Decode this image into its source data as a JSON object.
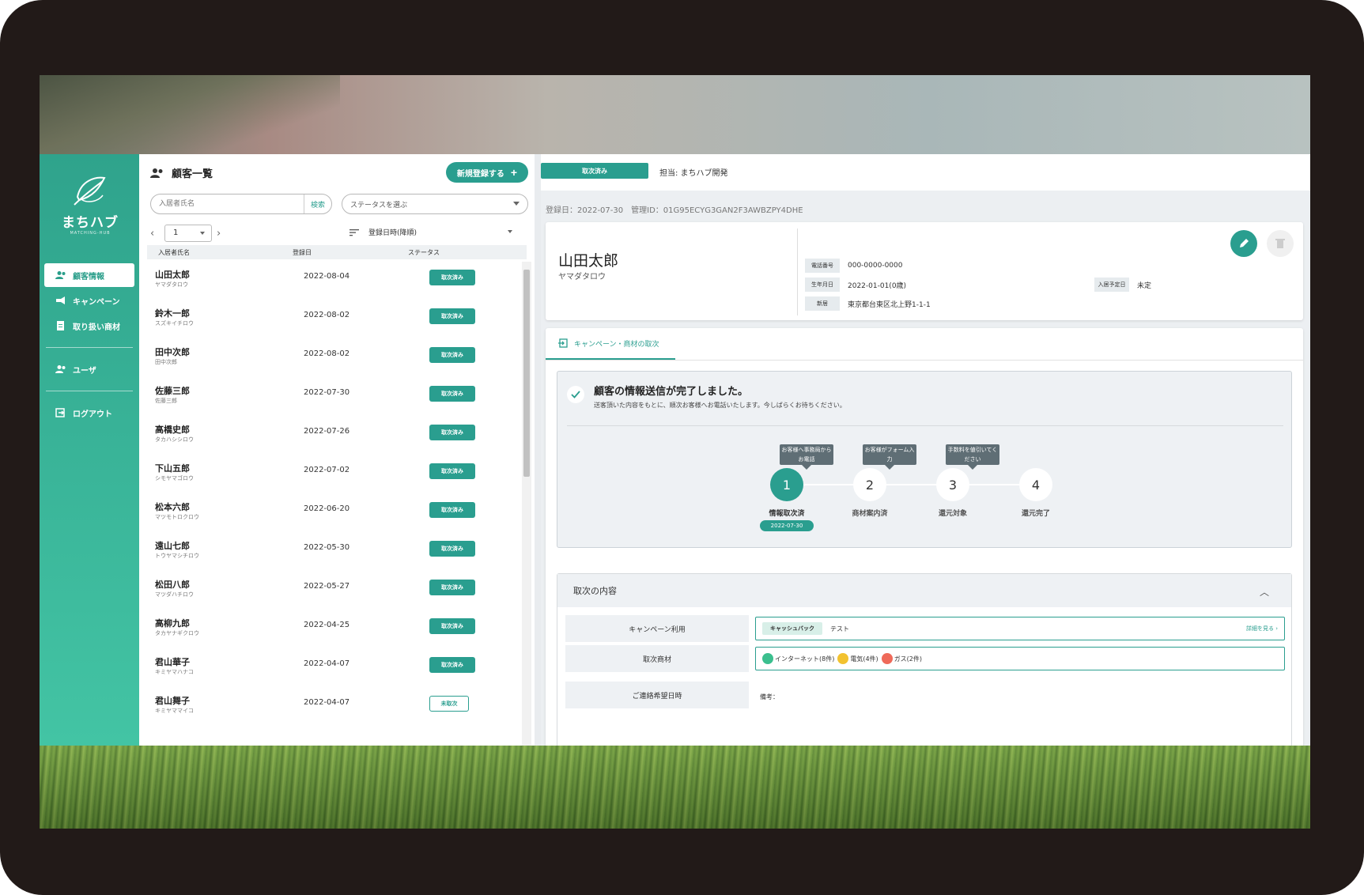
{
  "brand": {
    "name": "まちハブ",
    "sub": "MATCHING-HUB"
  },
  "sidebar": {
    "items": [
      {
        "label": "顧客情報",
        "icon": "users-icon",
        "active": true
      },
      {
        "label": "キャンペーン",
        "icon": "megaphone-icon"
      },
      {
        "label": "取り扱い商材",
        "icon": "document-icon"
      },
      {
        "label": "ユーザ",
        "icon": "users-icon"
      },
      {
        "label": "ログアウト",
        "icon": "logout-icon"
      }
    ]
  },
  "list": {
    "title": "顧客一覧",
    "new_button": "新規登録する",
    "search_placeholder": "入居者氏名",
    "search_button": "検索",
    "status_placeholder": "ステータスを選ぶ",
    "page": "1",
    "sort_label": "登録日時(降順)",
    "columns": {
      "name": "入居者氏名",
      "date": "登録日",
      "status": "ステータス"
    },
    "rows": [
      {
        "name": "山田太郎",
        "kana": "ヤマダタロウ",
        "date": "2022-08-04",
        "status": "取次済み"
      },
      {
        "name": "鈴木一郎",
        "kana": "スズキイチロウ",
        "date": "2022-08-02",
        "status": "取次済み"
      },
      {
        "name": "田中次郎",
        "kana": "田中次郎",
        "date": "2022-08-02",
        "status": "取次済み"
      },
      {
        "name": "佐藤三郎",
        "kana": "佐藤三郎",
        "date": "2022-07-30",
        "status": "取次済み"
      },
      {
        "name": "高橋史郎",
        "kana": "タカハシシロウ",
        "date": "2022-07-26",
        "status": "取次済み"
      },
      {
        "name": "下山五郎",
        "kana": "シモヤマゴロウ",
        "date": "2022-07-02",
        "status": "取次済み"
      },
      {
        "name": "松本六郎",
        "kana": "マツモトロクロウ",
        "date": "2022-06-20",
        "status": "取次済み"
      },
      {
        "name": "遠山七郎",
        "kana": "トウヤマシチロウ",
        "date": "2022-05-30",
        "status": "取次済み"
      },
      {
        "name": "松田八郎",
        "kana": "マツダハチロウ",
        "date": "2022-05-27",
        "status": "取次済み"
      },
      {
        "name": "高柳九郎",
        "kana": "タカヤナギクロウ",
        "date": "2022-04-25",
        "status": "取次済み"
      },
      {
        "name": "君山華子",
        "kana": "キミヤマハナコ",
        "date": "2022-04-07",
        "status": "取次済み"
      },
      {
        "name": "君山舞子",
        "kana": "キミヤママイコ",
        "date": "2022-04-07",
        "status": "未取次"
      }
    ]
  },
  "detail": {
    "status": "取次済み",
    "owner": "担当: まちハブ開発",
    "meta": "登録日：2022-07-30　管理ID：01G95ECYG3GAN2F3AWBZPY4DHE",
    "customer": {
      "name": "山田太郎",
      "kana": "ヤマダタロウ",
      "phone_label": "電話番号",
      "phone": "000-0000-0000",
      "birth_label": "生年月日",
      "birth": "2022-01-01(0歳)",
      "address_label": "新居",
      "address": "東京都台東区北上野1-1-1",
      "movein_label": "入居予定日",
      "movein": "未定"
    },
    "tab": "キャンペーン・商材の取次",
    "done_title": "顧客の情報送信が完了しました。",
    "done_sub": "送客頂いた内容をもとに、順次お客様へお電話いたします。今しばらくお待ちください。",
    "steps": [
      {
        "num": "1",
        "label": "情報取次済",
        "date": "2022-07-30"
      },
      {
        "num": "2",
        "label": "商材案内済"
      },
      {
        "num": "3",
        "label": "還元対象"
      },
      {
        "num": "4",
        "label": "還元完了"
      }
    ],
    "tips": [
      "お客様へ事務局からお電話",
      "お客様がフォーム入力",
      "手数料を値引いてください"
    ],
    "content_title": "取次の内容",
    "campaign_label": "キャンペーン利用",
    "campaign_chip": "キャッシュバック",
    "campaign_value": "テスト",
    "detail_link": "詳細を見る",
    "product_label": "取次商材",
    "products": [
      "インターネット(8件)",
      "電気(4件)",
      "ガス(2件)"
    ],
    "contact_label": "ご連絡希望日時",
    "note_label": "備考："
  },
  "colors": {
    "accent": "#2a9e8f",
    "sidebar_top": "#2fa38c",
    "sidebar_bottom": "#43c4a4"
  }
}
